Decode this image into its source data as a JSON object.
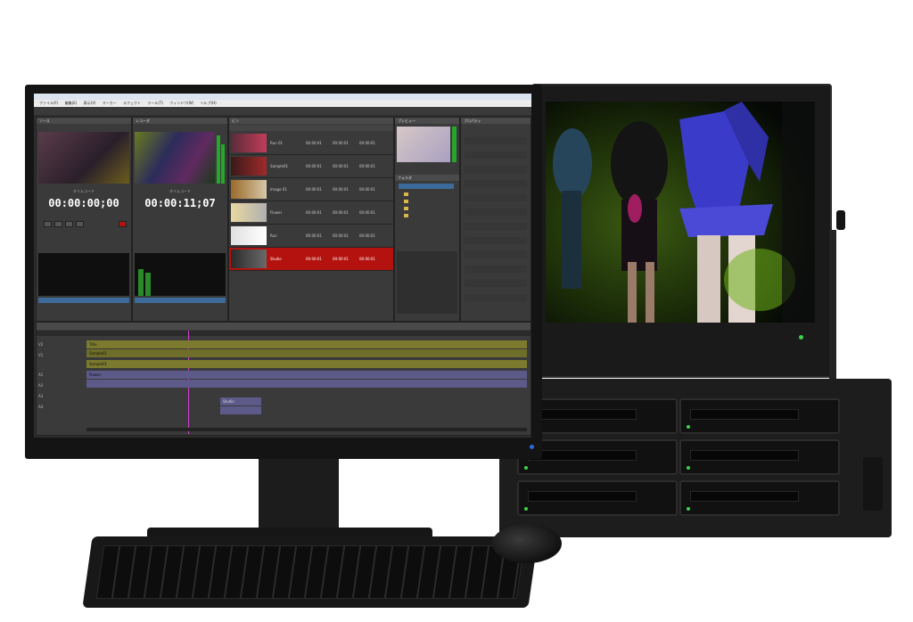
{
  "app": {
    "window_title": "NLE",
    "menus": [
      "ファイル(F)",
      "編集(E)",
      "表示(V)",
      "マーカー",
      "エフェクト",
      "ツール(T)",
      "ウィンドウ(W)",
      "ヘルプ(H)"
    ],
    "panel_titles": {
      "source": "ソース",
      "recorder": "レコーダ",
      "bin": "ビン",
      "preview": "プレビュー",
      "properties": "プロパティ",
      "folders": "フォルダ",
      "audio_meter": "オーディオメータ"
    }
  },
  "source_monitor": {
    "timecode_label": "タイムコード",
    "timecode": "00:00:00;00"
  },
  "record_monitor": {
    "timecode_label": "タイムコード",
    "timecode": "00:00:11;07"
  },
  "bin_rows": [
    {
      "name": "Run 01",
      "c1": "00:00:01",
      "c2": "00:00:01",
      "c3": "00:00:01"
    },
    {
      "name": "Sample01",
      "c1": "00:00:01",
      "c2": "00:00:01",
      "c3": "00:00:01"
    },
    {
      "name": "Image 01",
      "c1": "00:00:01",
      "c2": "00:00:01",
      "c3": "00:00:01"
    },
    {
      "name": "Flower",
      "c1": "00:00:01",
      "c2": "00:00:01",
      "c3": "00:00:01"
    },
    {
      "name": "Run",
      "c1": "00:00:01",
      "c2": "00:00:01",
      "c3": "00:00:01"
    },
    {
      "name": "Studio",
      "c1": "00:00:01",
      "c2": "00:00:01",
      "c3": "00:00:01"
    }
  ],
  "timeline": {
    "tracks": [
      "V2",
      "V1",
      "A1",
      "A2",
      "A3",
      "A4"
    ],
    "clips": [
      {
        "track": "V2",
        "label": "Title"
      },
      {
        "track": "V1",
        "label": "Sample01"
      },
      {
        "track": "A1",
        "label": "Sample01"
      },
      {
        "track": "A2",
        "label": "Flower"
      },
      {
        "track": "A3",
        "label": "Studio"
      }
    ]
  },
  "colors": {
    "accent_timecode": "#ffffff",
    "selected_row": "#b3120e",
    "video_clip": "#7b7a2e",
    "audio_clip": "#5d5a8a",
    "led": "#39d24a"
  },
  "icons": [
    "play-icon",
    "stop-icon",
    "rewind-icon",
    "fast-forward-icon",
    "record-icon",
    "folder-icon",
    "gear-icon"
  ]
}
